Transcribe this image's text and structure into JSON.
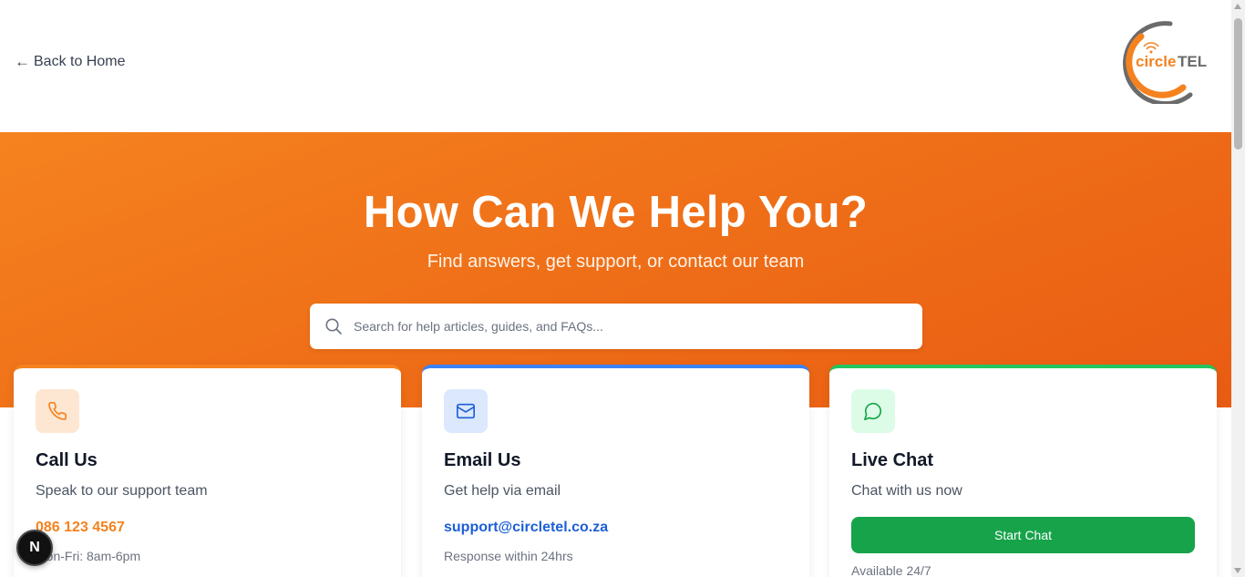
{
  "header": {
    "back_arrow": "←",
    "back_label": "Back to Home",
    "logo_text_circle": "circle",
    "logo_text_tel": "TEL"
  },
  "hero": {
    "title": "How Can We Help You?",
    "subtitle": "Find answers, get support, or contact our team"
  },
  "search": {
    "placeholder": "Search for help articles, guides, and FAQs..."
  },
  "cards": [
    {
      "icon": "phone-icon",
      "title": "Call Us",
      "description": "Speak to our support team",
      "contact": "086 123 4567",
      "note": "Mon-Fri: 8am-6pm",
      "accent": "#f5821f"
    },
    {
      "icon": "mail-icon",
      "title": "Email Us",
      "description": "Get help via email",
      "contact": "support@circletel.co.za",
      "note": "Response within 24hrs",
      "accent": "#3b82f6"
    },
    {
      "icon": "chat-bubble-icon",
      "title": "Live Chat",
      "description": "Chat with us now",
      "button_label": "Start Chat",
      "note": "Available 24/7",
      "accent": "#22c55e"
    }
  ],
  "dev_badge": {
    "label": "N"
  },
  "colors": {
    "brand_orange": "#f5821f",
    "brand_grey": "#6b6b6b",
    "chat_green": "#16a34a"
  }
}
